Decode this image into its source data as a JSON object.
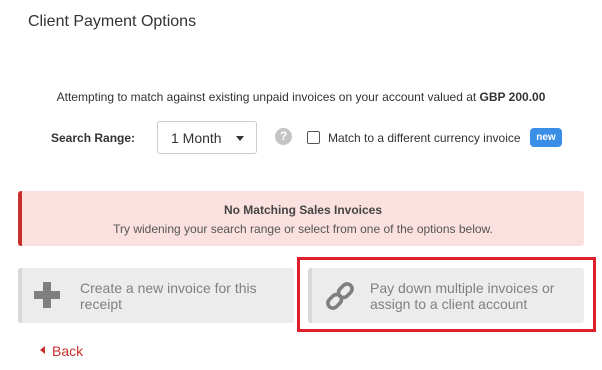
{
  "page": {
    "title": "Client Payment Options"
  },
  "match": {
    "prefix": "Attempting to match against existing unpaid invoices on your account valued at ",
    "amount": "GBP 200.00"
  },
  "search": {
    "label": "Search Range:",
    "range_value": "1 Month",
    "help_icon": "question-circle-icon",
    "help_glyph": "?",
    "currency_checkbox_checked": false,
    "currency_checkbox_label": "Match to a different currency invoice",
    "new_badge": "new"
  },
  "alert": {
    "title": "No Matching Sales Invoices",
    "text": "Try widening your search range or select from one of the options below."
  },
  "options": {
    "create": {
      "icon": "plus-icon",
      "label": "Create a new invoice for this receipt"
    },
    "pay_down": {
      "icon": "link-icon",
      "label": "Pay down multiple invoices or assign to a client account",
      "highlighted": true
    }
  },
  "nav": {
    "back_label": "Back"
  },
  "colors": {
    "alert_background": "#fbe0e0",
    "alert_border": "#c9302c",
    "badge": "#3a8ee6",
    "highlight": "#e0202a",
    "back_link": "#c9302c"
  }
}
